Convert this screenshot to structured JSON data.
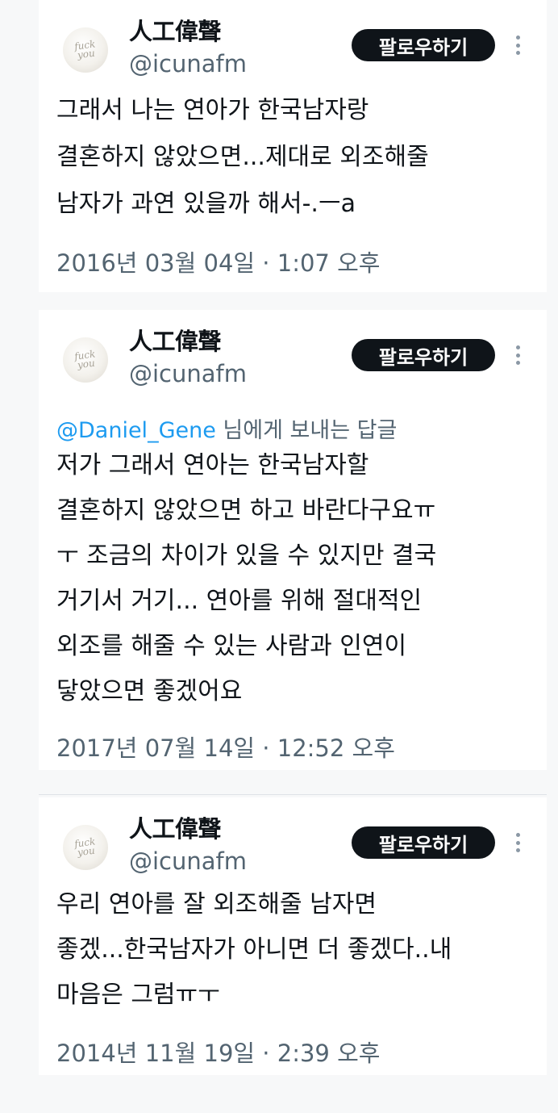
{
  "common": {
    "avatar_text_1": "fuck",
    "avatar_text_2": "you",
    "more_icon": "more-vertical-icon"
  },
  "tweets": [
    {
      "name": "人工偉聲",
      "handle": "@icunafm",
      "follow_label": "팔로우하기",
      "reply_to": "",
      "reply_suffix": "",
      "lines": [
        "그래서 나는 연아가 한국남자랑",
        "결혼하지 않았으면...제대로 외조해줄",
        "남자가 과연 있을까 해서-.ㅡa"
      ],
      "timestamp": "2016년 03월 04일 · 1:07 오후"
    },
    {
      "name": "人工偉聲",
      "handle": "@icunafm",
      "follow_label": "팔로우하기",
      "reply_to": "@Daniel_Gene",
      "reply_suffix": " 님에게 보내는 답글",
      "lines": [
        "저가 그래서 연아는 한국남자할",
        "결혼하지 않았으면 하고 바란다구요ㅠ",
        "ㅜ 조금의 차이가 있을 수 있지만 결국",
        "거기서 거기... 연아를 위해 절대적인",
        "외조를 해줄 수 있는 사람과 인연이",
        "닿았으면 좋겠어요"
      ],
      "timestamp": "2017년 07월 14일 · 12:52 오후"
    },
    {
      "name": "人工偉聲",
      "handle": "@icunafm",
      "follow_label": "팔로우하기",
      "reply_to": "",
      "reply_suffix": "",
      "lines": [
        "우리 연아를 잘 외조해줄 남자면",
        "좋겠...한국남자가 아니면 더 좋겠다..내",
        "마음은 그럼ㅠㅜ"
      ],
      "timestamp": "2014년 11월 19일 · 2:39 오후"
    }
  ]
}
